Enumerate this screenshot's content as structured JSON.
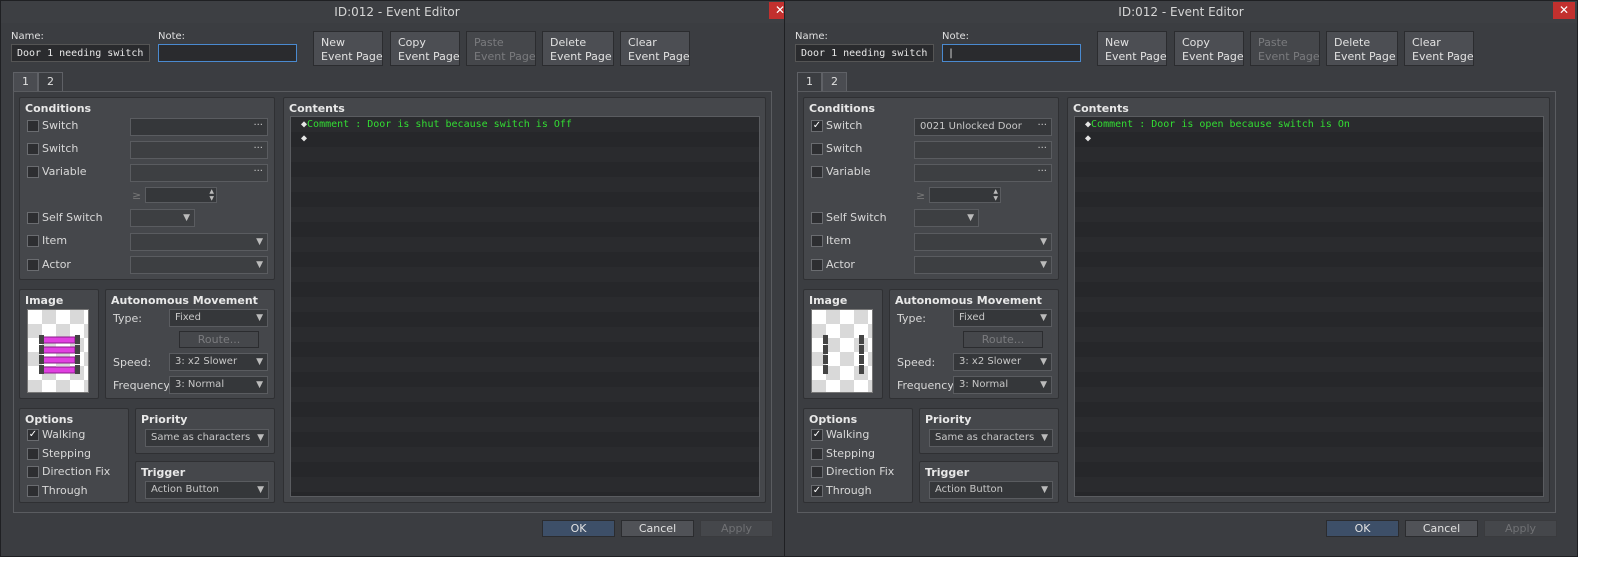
{
  "windows": [
    {
      "title": "ID:012 - Event Editor",
      "name_label": "Name:",
      "name_value": "Door 1 needing switch",
      "note_label": "Note:",
      "note_value": "",
      "buttons": {
        "new": "New\nEvent Page",
        "copy": "Copy\nEvent Page",
        "paste": "Paste\nEvent Page",
        "delete": "Delete\nEvent Page",
        "clear": "Clear\nEvent Page"
      },
      "tabs": [
        "1",
        "2"
      ],
      "active_tab": 0,
      "conditions": {
        "title": "Conditions",
        "switch1": {
          "label": "Switch",
          "checked": "",
          "value": ""
        },
        "switch2": {
          "label": "Switch",
          "checked": "",
          "value": ""
        },
        "variable": {
          "label": "Variable",
          "checked": "",
          "value": ""
        },
        "ge": "≥",
        "self_switch": {
          "label": "Self Switch",
          "checked": ""
        },
        "item": {
          "label": "Item",
          "checked": ""
        },
        "actor": {
          "label": "Actor",
          "checked": ""
        }
      },
      "image_title": "Image",
      "movement": {
        "title": "Autonomous Movement",
        "type_label": "Type:",
        "type_value": "Fixed",
        "route": "Route...",
        "speed_label": "Speed:",
        "speed_value": "3: x2 Slower",
        "freq_label": "Frequency:",
        "freq_value": "3: Normal"
      },
      "options": {
        "title": "Options",
        "walking": {
          "label": "Walking",
          "checked": "✓"
        },
        "stepping": {
          "label": "Stepping",
          "checked": ""
        },
        "direction_fix": {
          "label": "Direction Fix",
          "checked": ""
        },
        "through": {
          "label": "Through",
          "checked": ""
        }
      },
      "priority": {
        "title": "Priority",
        "value": "Same as characters"
      },
      "trigger": {
        "title": "Trigger",
        "value": "Action Button"
      },
      "contents": {
        "title": "Contents",
        "line1": "Comment : Door is shut because switch is Off"
      },
      "footer": {
        "ok": "OK",
        "cancel": "Cancel",
        "apply": "Apply"
      }
    },
    {
      "title": "ID:012 - Event Editor",
      "name_label": "Name:",
      "name_value": "Door 1 needing switch",
      "note_label": "Note:",
      "note_value": "|",
      "buttons": {
        "new": "New\nEvent Page",
        "copy": "Copy\nEvent Page",
        "paste": "Paste\nEvent Page",
        "delete": "Delete\nEvent Page",
        "clear": "Clear\nEvent Page"
      },
      "tabs": [
        "1",
        "2"
      ],
      "active_tab": 1,
      "conditions": {
        "title": "Conditions",
        "switch1": {
          "label": "Switch",
          "checked": "✓",
          "value": "0021 Unlocked Door"
        },
        "switch2": {
          "label": "Switch",
          "checked": "",
          "value": ""
        },
        "variable": {
          "label": "Variable",
          "checked": "",
          "value": ""
        },
        "ge": "≥",
        "self_switch": {
          "label": "Self Switch",
          "checked": ""
        },
        "item": {
          "label": "Item",
          "checked": ""
        },
        "actor": {
          "label": "Actor",
          "checked": ""
        }
      },
      "image_title": "Image",
      "movement": {
        "title": "Autonomous Movement",
        "type_label": "Type:",
        "type_value": "Fixed",
        "route": "Route...",
        "speed_label": "Speed:",
        "speed_value": "3: x2 Slower",
        "freq_label": "Frequency:",
        "freq_value": "3: Normal"
      },
      "options": {
        "title": "Options",
        "walking": {
          "label": "Walking",
          "checked": "✓"
        },
        "stepping": {
          "label": "Stepping",
          "checked": ""
        },
        "direction_fix": {
          "label": "Direction Fix",
          "checked": ""
        },
        "through": {
          "label": "Through",
          "checked": "✓"
        }
      },
      "priority": {
        "title": "Priority",
        "value": "Same as characters"
      },
      "trigger": {
        "title": "Trigger",
        "value": "Action Button"
      },
      "contents": {
        "title": "Contents",
        "line1": "Comment : Door is open because switch is On"
      },
      "footer": {
        "ok": "OK",
        "cancel": "Cancel",
        "apply": "Apply"
      }
    }
  ],
  "colors": {
    "window_bg": "#3b3d41",
    "comment_text": "#33dd33",
    "close_red": "#c2302e",
    "ok_blue": "#3d4f68"
  },
  "icons": {
    "close": "close-icon",
    "dropdown": "chevron-down-icon",
    "ellipsis": "ellipsis-icon",
    "spinner": "spinner-arrows-icon",
    "command_marker": "diamond-icon"
  }
}
